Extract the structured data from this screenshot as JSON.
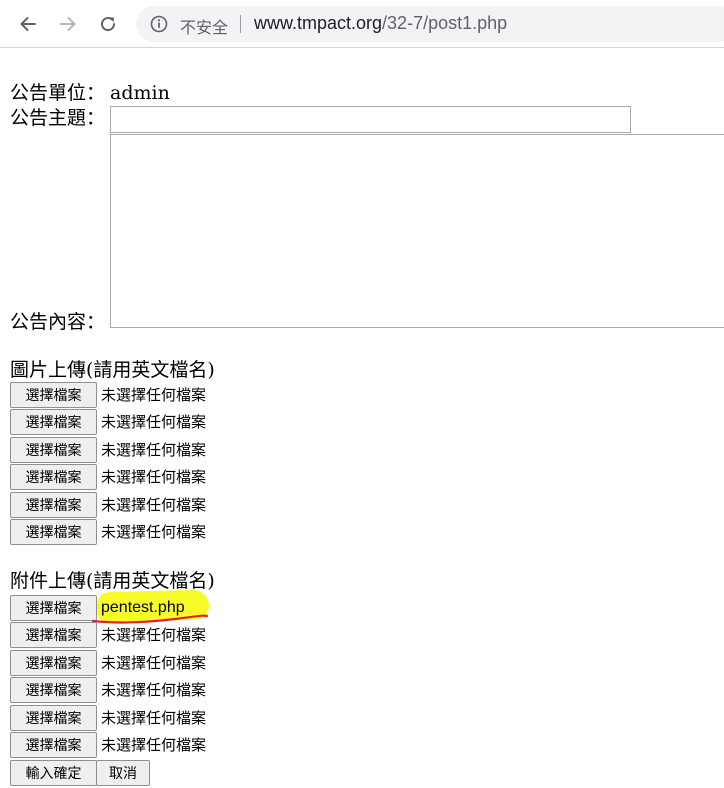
{
  "browser": {
    "security_label": "不安全",
    "url_host": "www.tmpact.org",
    "url_path": "/32-7/post1.php"
  },
  "form": {
    "unit_label": "公告單位：",
    "unit_value": "admin",
    "subject_label": "公告主題：",
    "subject_value": "",
    "content_label": "公告內容：",
    "content_value": "",
    "image_section_label": "圖片上傳(請用英文檔名)",
    "attachment_section_label": "附件上傳(請用英文檔名)",
    "choose_file_label": "選擇檔案",
    "no_file_text": "未選擇任何檔案",
    "attachment_selected_file": "pentest.php",
    "submit_label": "輸入確定",
    "cancel_label": "取消"
  },
  "colors": {
    "highlight": "#f7fb2a",
    "underline": "#e0202a"
  },
  "icons": [
    "back-arrow-icon",
    "forward-arrow-icon",
    "reload-icon",
    "info-icon"
  ]
}
